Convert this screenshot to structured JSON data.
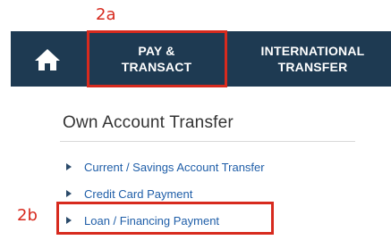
{
  "annotations": {
    "label_2a": "2a",
    "label_2b": "2b",
    "highlight_color": "#d72a1e"
  },
  "navbar": {
    "background": "#1e3a52",
    "home_icon": "home-icon",
    "pay_transact": {
      "line1": "PAY &",
      "line2": "TRANSACT"
    },
    "international_transfer": {
      "line1": "INTERNATIONAL",
      "line2": "TRANSFER"
    }
  },
  "section": {
    "title": "Own Account Transfer",
    "links": [
      {
        "label": "Current / Savings Account Transfer",
        "icon": "triangle-bullet-icon"
      },
      {
        "label": "Credit Card Payment",
        "icon": "triangle-bullet-icon"
      },
      {
        "label": "Loan / Financing Payment",
        "icon": "triangle-bullet-icon"
      }
    ],
    "link_color": "#1f5ea8"
  }
}
